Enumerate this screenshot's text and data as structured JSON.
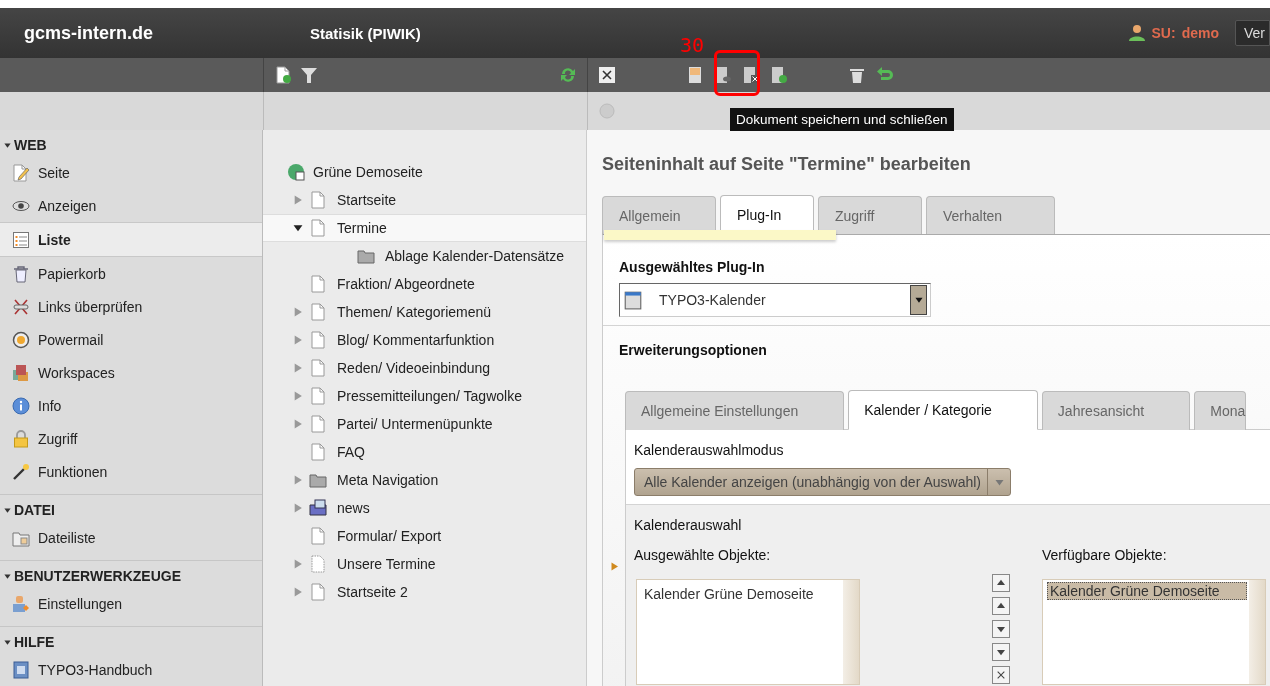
{
  "topbar": {
    "site": "gcms-intern.de",
    "module_title": "Statisik (PIWIK)",
    "user_prefix": "SU:",
    "user_name": "demo",
    "cut_button": "Ver"
  },
  "modules": [
    {
      "title": "WEB",
      "expanded": true,
      "items": [
        {
          "label": "Seite",
          "selected": false
        },
        {
          "label": "Anzeigen",
          "selected": false
        },
        {
          "label": "Liste",
          "selected": true
        },
        {
          "label": "Papierkorb",
          "selected": false
        },
        {
          "label": "Links überprüfen",
          "selected": false
        },
        {
          "label": "Powermail",
          "selected": false
        },
        {
          "label": "Workspaces",
          "selected": false
        },
        {
          "label": "Info",
          "selected": false
        },
        {
          "label": "Zugriff",
          "selected": false
        },
        {
          "label": "Funktionen",
          "selected": false
        }
      ]
    },
    {
      "title": "DATEI",
      "expanded": true,
      "items": [
        {
          "label": "Dateiliste",
          "selected": false
        }
      ]
    },
    {
      "title": "BENUTZERWERKZEUGE",
      "expanded": true,
      "items": [
        {
          "label": "Einstellungen",
          "selected": false
        }
      ]
    },
    {
      "title": "HILFE",
      "expanded": true,
      "items": [
        {
          "label": "TYPO3-Handbuch",
          "selected": false
        }
      ]
    }
  ],
  "tree": {
    "root": "Grüne Demoseite",
    "nodes": [
      {
        "label": "Startseite",
        "kind": "page",
        "expanded": false,
        "selected": false
      },
      {
        "label": "Termine",
        "kind": "page",
        "expanded": true,
        "selected": true,
        "children": [
          {
            "label": "Ablage Kalender-Datensätze",
            "kind": "folder",
            "selected": false
          }
        ]
      },
      {
        "label": "Fraktion/ Abgeordnete",
        "kind": "page",
        "selected": false
      },
      {
        "label": "Themen/ Kategoriemenü",
        "kind": "page",
        "expanded": false,
        "selected": false
      },
      {
        "label": "Blog/ Kommentarfunktion",
        "kind": "page",
        "expanded": false,
        "selected": false
      },
      {
        "label": "Reden/ Videoeinbindung",
        "kind": "page",
        "expanded": false,
        "selected": false
      },
      {
        "label": "Pressemitteilungen/ Tagwolke",
        "kind": "page",
        "expanded": false,
        "selected": false
      },
      {
        "label": "Partei/ Untermenüpunkte",
        "kind": "page",
        "expanded": false,
        "selected": false
      },
      {
        "label": "FAQ",
        "kind": "page",
        "selected": false
      },
      {
        "label": "Meta Navigation",
        "kind": "folder",
        "expanded": false,
        "selected": false
      },
      {
        "label": "news",
        "kind": "news",
        "expanded": false,
        "selected": false
      },
      {
        "label": "Formular/ Export",
        "kind": "page",
        "selected": false
      },
      {
        "label": "Unsere Termine",
        "kind": "hidden",
        "expanded": false,
        "selected": false
      },
      {
        "label": "Startseite 2",
        "kind": "page",
        "expanded": false,
        "selected": false
      }
    ]
  },
  "doc_toolbar": {
    "annotation": "30",
    "tooltip": "Dokument speichern und schließen"
  },
  "content": {
    "heading": "Seiteninhalt auf Seite \"Termine\" bearbeiten",
    "tabs": [
      {
        "label": "Allgemein",
        "selected": false
      },
      {
        "label": "Plug-In",
        "selected": true
      },
      {
        "label": "Zugriff",
        "selected": false
      },
      {
        "label": "Verhalten",
        "selected": false
      }
    ],
    "plugin_label": "Ausgewähltes Plug-In",
    "plugin_value": "TYPO3-Kalender",
    "options_label": "Erweiterungsoptionen",
    "subtabs": [
      {
        "label": "Allgemeine Einstellungen",
        "selected": false
      },
      {
        "label": "Kalender / Kategorie",
        "selected": true
      },
      {
        "label": "Jahresansicht",
        "selected": false
      },
      {
        "label": "Mona",
        "selected": false
      }
    ],
    "mode_label": "Kalenderauswahlmodus",
    "mode_value": "Alle Kalender anzeigen (unabhängig von der Auswahl)",
    "selection_label": "Kalenderauswahl",
    "selected_label": "Ausgewählte Objekte:",
    "selected_items": [
      {
        "label": "Kalender Grüne Demoseite",
        "selected": false
      }
    ],
    "available_label": "Verfügbare Objekte:",
    "available_items": [
      {
        "label": "Kalender Grüne Demoseite",
        "selected": true
      }
    ]
  }
}
